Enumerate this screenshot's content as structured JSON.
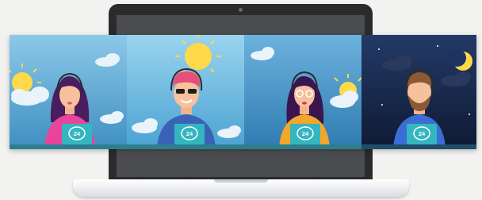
{
  "panels": [
    {
      "name": "morning-operator",
      "badge": "24",
      "sky": "#6fb8df",
      "shirt": "#e8449b",
      "hair": "#4a1d5e"
    },
    {
      "name": "noon-operator",
      "badge": "24",
      "sky": "#7ac3e6",
      "shirt": "#3a63b8",
      "hair": "#e4507a"
    },
    {
      "name": "afternoon-operator",
      "badge": "24",
      "sky": "#4b9bcc",
      "shirt": "#f2a62a",
      "hair": "#3a1550"
    },
    {
      "name": "night-operator",
      "badge": "24",
      "sky": "#1b2b4f",
      "shirt": "#3a6ed6",
      "hair": "#8b5a34"
    }
  ],
  "colors": {
    "desk": "#2f9fb0",
    "laptop_screen_bezel": "#2b2b2d",
    "monitor": "#34b6c0"
  }
}
